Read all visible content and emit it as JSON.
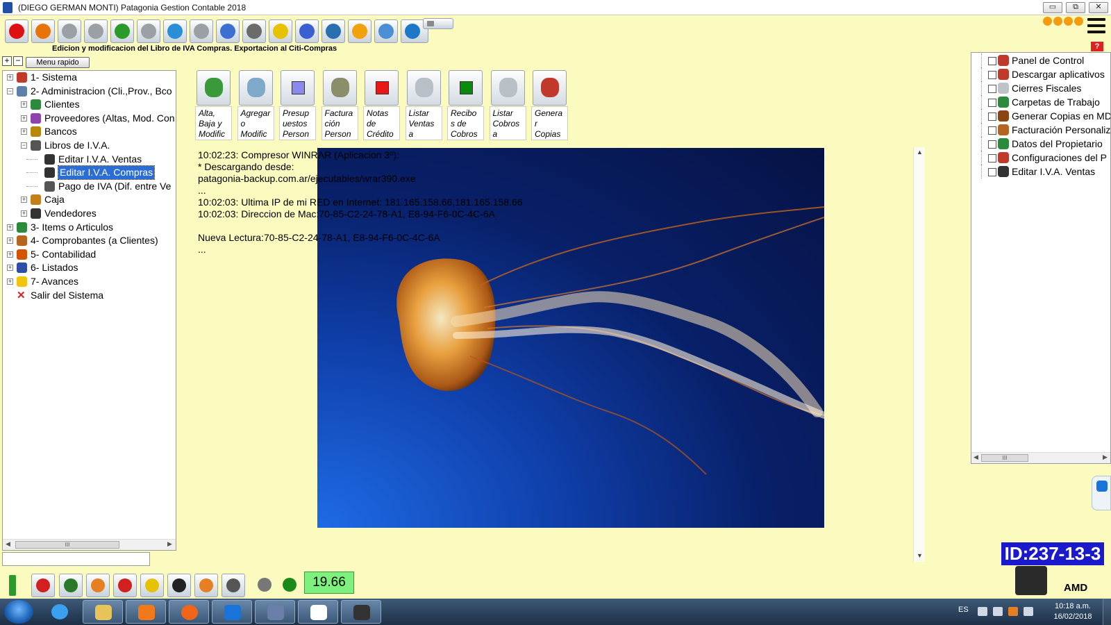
{
  "window": {
    "title": "(DIEGO GERMAN MONTI) Patagonia Gestion Contable 2018",
    "min_label": "▭",
    "max_label": "⧉",
    "close_label": "✕"
  },
  "toolbar": {
    "subtitle": "Edicion y modificacion del Libro de IVA Compras. Exportacion al Citi-Compras",
    "icons": [
      "stop-icon",
      "bug-icon",
      "user-gray-icon",
      "people-gray-icon",
      "download-icon",
      "hand-icon",
      "globe-icon",
      "user-silhouette-icon",
      "clock-icon",
      "printer-icon",
      "tag-icon",
      "bar-chart-icon",
      "camera-icon",
      "radiation-icon",
      "hands-icon",
      "landscape-icon",
      "grid-icon"
    ],
    "help_label": "?"
  },
  "left_panel": {
    "expand_label": "+",
    "collapse_label": "−",
    "menu_rapido_label": "Menu rapido",
    "tree": [
      {
        "label": "1- Sistema",
        "icon": "gear-icon",
        "icon_color": "#c0392b"
      },
      {
        "label": "2- Administracion (Cli.,Prov., Bco",
        "icon": "admin-icon",
        "icon_color": "#5d7fa8"
      },
      {
        "label": "Clientes",
        "icon": "clients-icon",
        "icon_color": "#2c8a3c"
      },
      {
        "label": "Proveedores (Altas, Mod. Con",
        "icon": "suppliers-icon",
        "icon_color": "#8e44ad"
      },
      {
        "label": "Bancos",
        "icon": "bank-icon",
        "icon_color": "#b8860b"
      },
      {
        "label": "Libros de I.V.A.",
        "icon": "books-icon",
        "icon_color": "#555555"
      },
      {
        "label": "Editar I.V.A. Ventas",
        "icon": "person-icon",
        "icon_color": "#333333"
      },
      {
        "label": "Editar I.V.A. Compras",
        "icon": "person-icon",
        "icon_color": "#333333"
      },
      {
        "label": "Pago de IVA (Dif. entre Ve",
        "icon": "books-icon",
        "icon_color": "#555555"
      },
      {
        "label": "Caja",
        "icon": "cash-icon",
        "icon_color": "#c47f1a"
      },
      {
        "label": "Vendedores",
        "icon": "sellers-icon",
        "icon_color": "#333333"
      },
      {
        "label": "3- Items o Articulos",
        "icon": "items-icon",
        "icon_color": "#2c8a3c"
      },
      {
        "label": "4- Comprobantes (a Clientes)",
        "icon": "receipt-icon",
        "icon_color": "#b5651d"
      },
      {
        "label": "5- Contabilidad",
        "icon": "ledger-icon",
        "icon_color": "#d35400"
      },
      {
        "label": "6- Listados",
        "icon": "chart-icon",
        "icon_color": "#2e4fa8"
      },
      {
        "label": "7- Avances",
        "icon": "smiley-icon",
        "icon_color": "#f1c40f"
      },
      {
        "label": "Salir del Sistema",
        "icon": "exit-x-icon",
        "icon_color": "#d22222"
      }
    ],
    "scroll_grip": "III",
    "scroll_left": "◀",
    "scroll_right": "▶"
  },
  "actions": [
    {
      "label": "Alta,\nBaja y\nModific",
      "icon": "client-person-icon",
      "color": "#3a9a3a"
    },
    {
      "label": "Agregar\no\nModific",
      "icon": "add-user-icon",
      "color": "#7fa9c9"
    },
    {
      "label": "Presup\nuestos\nPerson",
      "icon": "square-icon",
      "color": "#8a8aee"
    },
    {
      "label": "Factura\nción\nPerson",
      "icon": "register-icon",
      "color": "#8a8f6a"
    },
    {
      "label": "Notas\nde\nCrédito",
      "icon": "square-icon",
      "color": "#e81818"
    },
    {
      "label": "Listar\nVentas\na",
      "icon": "list-icon",
      "color": "#b8bfc6"
    },
    {
      "label": "Recibo\ns de\nCobros",
      "icon": "square-icon",
      "color": "#0a8a0a"
    },
    {
      "label": "Listar\nCobros\na",
      "icon": "list-icon",
      "color": "#b8bfc6"
    },
    {
      "label": "Genera\nr\nCopias",
      "icon": "copies-icon",
      "color": "#c0392b"
    }
  ],
  "log": [
    "10:02:23: Compresor WINRAR (Aplicacion 3º):",
    "* Descargando desde:",
    "patagonia-backup.com.ar/ejecutables/wrar390.exe",
    "...",
    "10:02:03: Ultima IP de mi RED en Internet: 181.165.158.66,181.165.158.66",
    "10:02:03: Direccion de Mac:70-85-C2-24-78-A1, E8-94-F6-0C-4C-6A",
    "",
    "Nueva Lectura:70-85-C2-24-78-A1, E8-94-F6-0C-4C-6A",
    "..."
  ],
  "center_scroll": {
    "up": "▲",
    "down": "▼"
  },
  "right_panel": {
    "items": [
      {
        "label": "Panel de Control",
        "icon": "gear-icon",
        "color": "#c0392b"
      },
      {
        "label": "Descargar aplicativos",
        "icon": "download-app-icon",
        "color": "#c0392b"
      },
      {
        "label": "Cierres Fiscales",
        "icon": "fiscal-icon",
        "color": "#bdc3c7"
      },
      {
        "label": "Carpetas de Trabajo",
        "icon": "folder-icon",
        "color": "#2c8a3c"
      },
      {
        "label": "Generar Copias en MD",
        "icon": "copies-icon",
        "color": "#8b4513"
      },
      {
        "label": "Facturación Personaliz",
        "icon": "invoice-icon",
        "color": "#b5651d"
      },
      {
        "label": "Datos del Propietario",
        "icon": "owner-icon",
        "color": "#2c8a3c"
      },
      {
        "label": "Configuraciones del P",
        "icon": "gear-icon",
        "color": "#c0392b"
      },
      {
        "label": "Editar I.V.A. Ventas",
        "icon": "person-icon",
        "color": "#333333"
      }
    ],
    "scroll_grip": "III",
    "scroll_left": "◀",
    "scroll_right": "▶"
  },
  "id_badge": "ID:237-13-3",
  "amd_label": "AMD",
  "bottom_tools": [
    "battery-icon",
    "pdf-icon",
    "network-icon",
    "gear-orange-icon",
    "apple-icon",
    "tag-icon",
    "clock-icon",
    "swoosh-icon",
    "printer-check-icon",
    "coins-icon",
    "dollar-icon"
  ],
  "counter_value": "19.66",
  "taskbar": {
    "apps": [
      "ie-icon",
      "explorer-icon",
      "media-player-icon",
      "firefox-icon",
      "teamviewer-icon",
      "patagonia-app-icon",
      "patagonia-logo-icon",
      "agent-icon"
    ],
    "lang": "ES",
    "time": "10:18 a.m.",
    "date": "16/02/2018"
  }
}
